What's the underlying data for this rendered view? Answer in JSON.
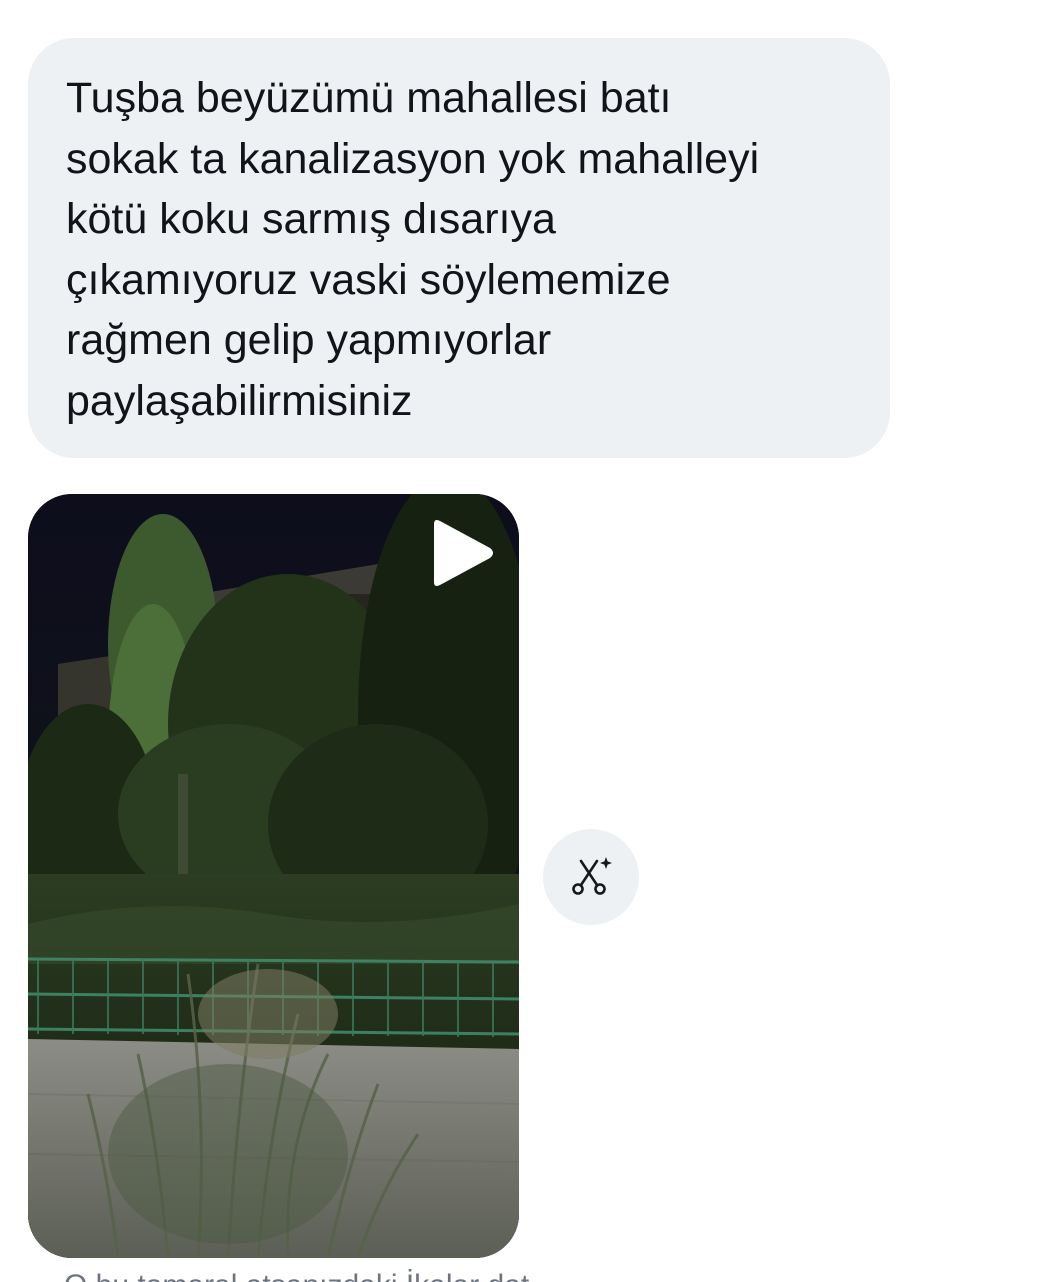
{
  "message": {
    "text": "Tuşba beyüzümü mahallesi batı\nsokak ta kanalizasyon yok mahalleyi\nkötü koku sarmış dısarıya\nçıkamıyoruz vaski söylememize\nrağmen gelip yapmıyorlar\npaylaşabilirmisiniz"
  },
  "video": {
    "play_icon": "play-icon",
    "scene": "night photo of trees, grass, a green fence and a building"
  },
  "actions": {
    "trim_icon": "scissors-sparkle-icon"
  },
  "footer": {
    "cut_text": "O bu tamaral atsanızdaki İkalar dat"
  },
  "colors": {
    "bubble_bg": "#eef1f4",
    "text": "#111418",
    "muted_text": "#6b7480"
  }
}
